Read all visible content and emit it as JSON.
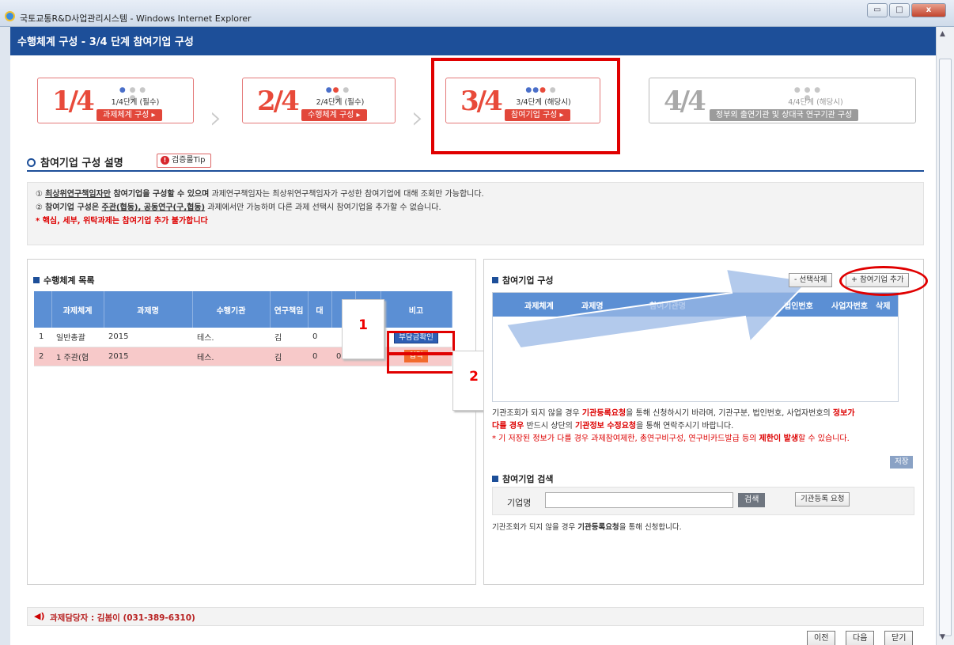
{
  "window": {
    "title": "국토교통R&D사업관리시스템 - Windows Internet Explorer",
    "buttons": {
      "minimize": "▭",
      "maximize": "□",
      "close": "x"
    }
  },
  "page": {
    "title": "수행체계 구성 - 3/4 단계 참여기업 구성"
  },
  "steps": [
    {
      "big": "1/4",
      "label": "1/4단계 (필수)",
      "button": "과제체계 구성 ▸"
    },
    {
      "big": "2/4",
      "label": "2/4단계 (필수)",
      "button": "수행체계 구성 ▸"
    },
    {
      "big": "3/4",
      "label": "3/4단계 (해당시)",
      "button": "참여기업 구성 ▸"
    },
    {
      "big": "4/4",
      "label": "4/4단계 (해당시)",
      "button": "정부외 출연기관 및 상대국 연구기관 구성"
    }
  ],
  "section": {
    "title": "참여기업 구성 설명",
    "tip_label": "검증룰Tip"
  },
  "notes": {
    "line1_prefix": "① ",
    "line1_underline": "최상위연구책임자만",
    "line1_bold": " 참여기업을 구성할 수 있으며",
    "line1_rest": " 과제연구책임자는 최상위연구책임자가 구성한 참여기업에 대해 조회만 가능합니다.",
    "line2_prefix": "② ",
    "line2_bold": "참여기업 구성은 ",
    "line2_underline": "주관(협동), 공동연구(구,협동)",
    "line2_rest": " 과제에서만 가능하며 다른 과제 선택시 참여기업을 추가할 수 없습니다.",
    "line3": "* 핵심, 세부, 위탁과제는 참여기업 추가 불가합니다"
  },
  "left_panel": {
    "title": "수행체계 목록",
    "columns": [
      "",
      "과제체계",
      "과제명",
      "수행기관",
      "연구책임",
      "대",
      "",
      "",
      "비고"
    ],
    "rows": [
      {
        "no": "1",
        "type": "일반총괄",
        "name": "2015",
        "org": "테스.",
        "lead": "김",
        "v1": "0",
        "v2": "",
        "v3": "",
        "action": "부담금확인"
      },
      {
        "no": "2",
        "type": "1 주관(협",
        "name": "2015",
        "org": "테스.",
        "lead": "김",
        "v1": "0",
        "v2": "0",
        "v3": "0",
        "action": "입력"
      }
    ]
  },
  "callouts": {
    "one": "1",
    "two": "2"
  },
  "right_panel": {
    "title": "참여기업 구성",
    "delete_button": "- 선택삭제",
    "add_button": "+ 참여기업 추가",
    "columns": [
      "과제체계",
      "과제명",
      "참여기관명",
      "법인번호",
      "사업자번호",
      "삭제"
    ],
    "warn_1a": "기관조회가 되지 않을 경우 ",
    "warn_1b": "기관등록요청",
    "warn_1c": "을 통해 신청하시기 바라며, 기관구분, 법인번호, 사업자번호의 ",
    "warn_1d": "정보가",
    "warn_2a": "다를 경우",
    "warn_2b": " 반드시 상단의 ",
    "warn_2c": "기관정보 수정요청",
    "warn_2d": "을 통해 연락주시기 바랍니다.",
    "warn_3": "* 기 저장된 정보가 다를 경우 과제참여제한, 총연구비구성, 연구비카드발급 등의 ",
    "warn_3b": "제한이 발생",
    "warn_3c": "할 수 있습니다.",
    "save_button": "저장"
  },
  "search_panel": {
    "title": "참여기업 검색",
    "label": "기업명",
    "input_value": "",
    "search_button": "검색",
    "register_button": "기관등록 요청",
    "hint_a": "기관조회가 되지 않을 경우 ",
    "hint_b": "기관등록요청",
    "hint_c": "을 통해 신청합니다."
  },
  "footer": {
    "contact": "과제담당자 : 김봄이 (031-389-6310)"
  },
  "nav": {
    "prev": "이전",
    "next": "다음",
    "close": "닫기"
  },
  "colors": {
    "header_blue": "#1d4f99",
    "grid_header": "#5b8fd4",
    "highlight_red": "#e00000"
  }
}
